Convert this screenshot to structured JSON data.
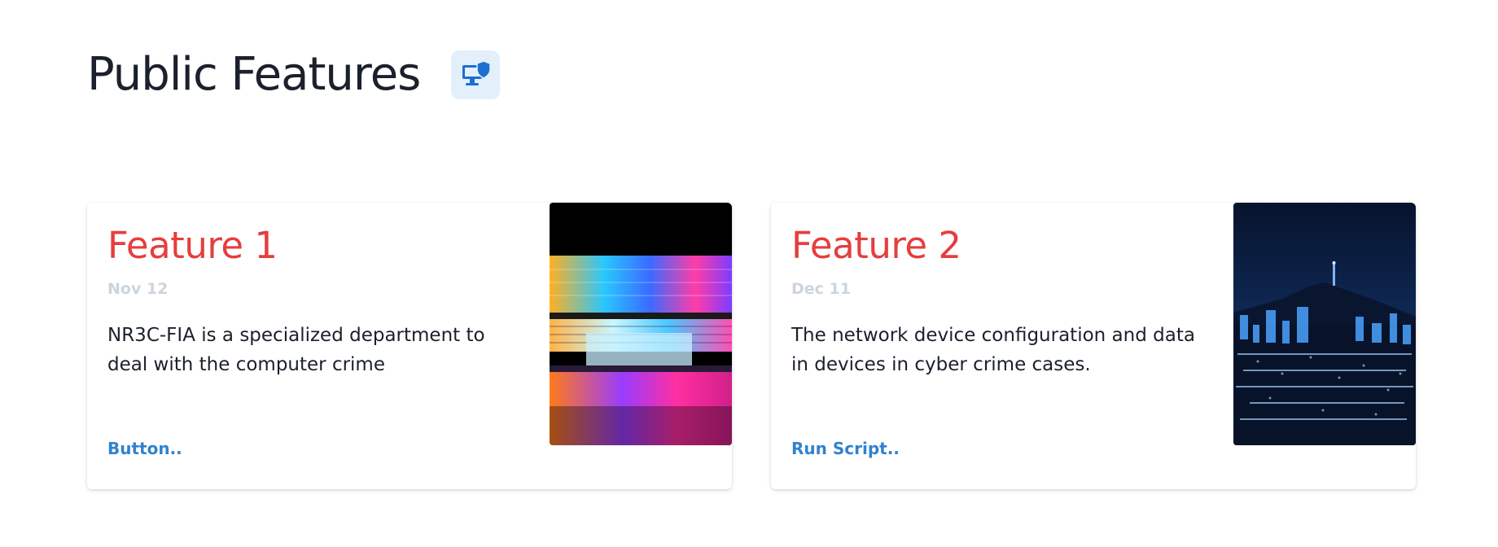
{
  "page": {
    "title": "Public Features",
    "title_icon": "monitor-shield-icon"
  },
  "features": [
    {
      "title": "Feature 1",
      "date": "Nov 12",
      "description": "NR3C-FIA is a specialized department to deal with the computer crime",
      "action_label": "Button..",
      "image": "colorful-laptop-keyboard-image"
    },
    {
      "title": "Feature 2",
      "date": "Dec 11",
      "description": "The network device configuration and data in devices in cyber crime cases.",
      "action_label": "Run Script..",
      "image": "night-city-skyline-image"
    }
  ],
  "colors": {
    "title": "#1a202c",
    "card_title": "#e53e3e",
    "date": "#cbd5e0",
    "link": "#3182ce",
    "icon_bg": "#e3effb",
    "icon": "#1e6fd0"
  }
}
